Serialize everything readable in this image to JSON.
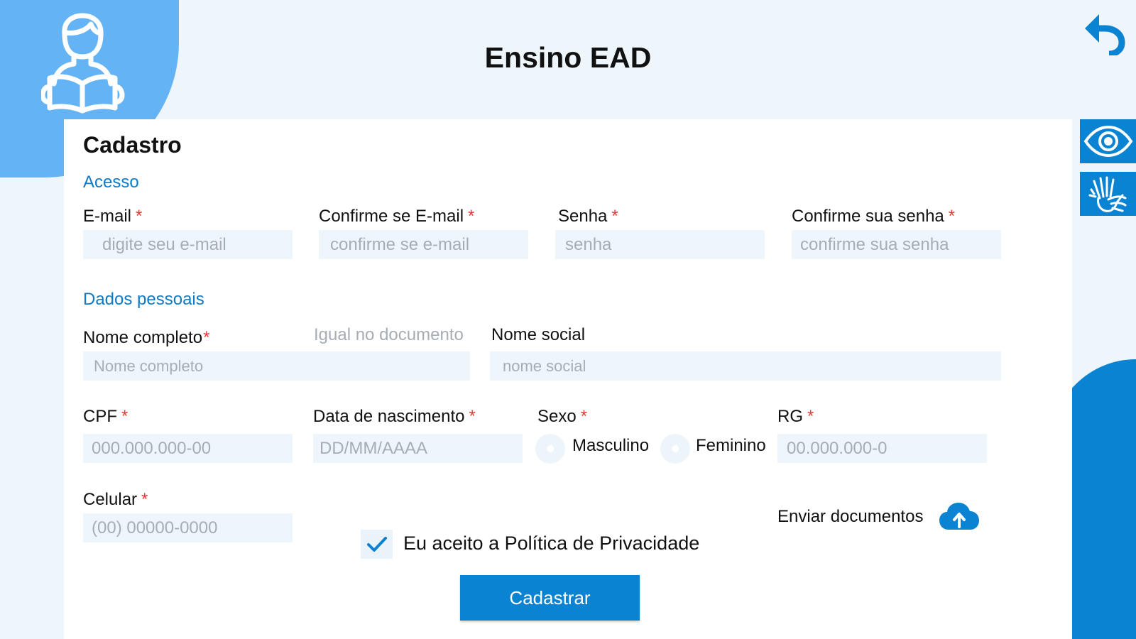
{
  "header": {
    "title": "Ensino EAD"
  },
  "icons": {
    "avatar": "student-reading-icon",
    "back": "undo-arrow-icon",
    "accessibility_visual": "eye-icon",
    "accessibility_sign_language": "sign-language-hands-icon",
    "upload": "cloud-upload-icon",
    "consent_check": "checkmark-icon"
  },
  "colors": {
    "primary": "#0b83d3",
    "light_blue": "#64b4f5",
    "background": "#eef6fc",
    "section_text": "#0f7bc6",
    "required": "#e53935",
    "placeholder": "#a6adb4"
  },
  "form": {
    "title": "Cadastro",
    "required_mark": "*",
    "sections": {
      "access": "Acesso",
      "personal": "Dados pessoais"
    },
    "fields": {
      "email": {
        "label": "E-mail",
        "placeholder": "digite seu e-mail"
      },
      "email_confirm": {
        "label": "Confirme se E-mail",
        "placeholder": "confirme se e-mail"
      },
      "password": {
        "label": "Senha",
        "placeholder": "senha"
      },
      "password_confirm": {
        "label": "Confirme sua senha",
        "placeholder": "confirme sua senha"
      },
      "full_name": {
        "label": "Nome completo",
        "hint": "Igual no documento",
        "placeholder": "Nome completo"
      },
      "social_name": {
        "label": "Nome social",
        "placeholder": "nome social"
      },
      "cpf": {
        "label": "CPF",
        "placeholder": "000.000.000-00"
      },
      "birth_date": {
        "label": "Data de nascimento",
        "placeholder": "DD/MM/AAAA"
      },
      "sex": {
        "label": "Sexo",
        "options": [
          "Masculino",
          "Feminino"
        ]
      },
      "rg": {
        "label": "RG",
        "placeholder": "00.000.000-0"
      },
      "phone": {
        "label": "Celular",
        "placeholder": "(00) 00000-0000"
      }
    },
    "consent": {
      "label": "Eu aceito a Política de Privacidade",
      "checked": true
    },
    "upload": {
      "label": "Enviar documentos"
    },
    "submit": {
      "label": "Cadastrar"
    }
  }
}
